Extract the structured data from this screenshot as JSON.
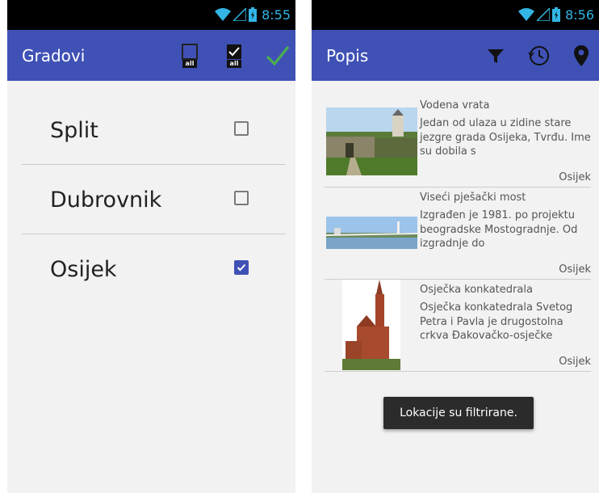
{
  "left_screen": {
    "status_time": "8:55",
    "title": "Gradovi",
    "actions": [
      {
        "label": "all",
        "icon": "checkbox-empty-all-icon"
      },
      {
        "label": "all",
        "icon": "checkbox-filled-all-icon"
      },
      {
        "icon": "checkmark-icon",
        "color": "#4caf50"
      }
    ],
    "cities": [
      {
        "name": "Split",
        "checked": false
      },
      {
        "name": "Dubrovnik",
        "checked": false
      },
      {
        "name": "Osijek",
        "checked": true
      }
    ]
  },
  "right_screen": {
    "status_time": "8:56",
    "title": "Popis",
    "actions": [
      {
        "icon": "filter-icon"
      },
      {
        "icon": "history-clock-icon"
      },
      {
        "icon": "location-pin-icon"
      }
    ],
    "locations": [
      {
        "title": "Vodena vrata",
        "description": " Jedan od ulaza u zidine stare jezgre grada Osijeka, Tvrđu. Ime su dobila s",
        "city": "Osijek"
      },
      {
        "title": "Viseći pješački most",
        "description": "Izgrađen je 1981. po projektu beogradske Mostogradnje. Od izgradnje do",
        "city": "Osijek"
      },
      {
        "title": "Osječka konkatedrala",
        "description": "Osječka konkatedrala Svetog Petra i Pavla je drugostolna crkva Đakovačko-osječke",
        "city": "Osijek"
      }
    ],
    "toast": "Lokacije su filtrirane."
  },
  "colors": {
    "app_bar": "#3f51b5",
    "status_bar": "#000000",
    "status_icons": "#33b5e5",
    "accent_check": "#4caf50",
    "checkbox_checked": "#3f51b5"
  }
}
